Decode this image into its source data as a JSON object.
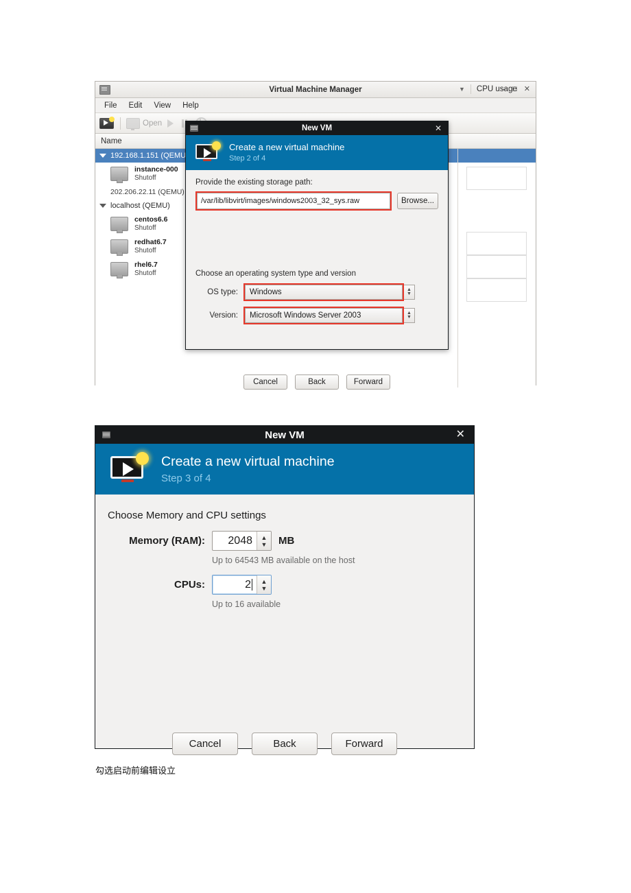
{
  "main_window": {
    "title": "Virtual Machine Manager",
    "window_controls": {
      "minimize": "–",
      "maximize": "□",
      "close": "✕"
    },
    "menu": [
      {
        "label": "File"
      },
      {
        "label": "Edit"
      },
      {
        "label": "View"
      },
      {
        "label": "Help"
      }
    ],
    "toolbar": {
      "new_vm_tooltip": "Create a new virtual machine",
      "open_label": "Open"
    },
    "columns": {
      "name": "Name",
      "cpu_usage": "CPU usage"
    },
    "tree": [
      {
        "type": "host",
        "label": "192.168.1.151 (QEMU)",
        "selected": true,
        "expanded": true
      },
      {
        "type": "vm",
        "name": "instance-000",
        "state": "Shutoff"
      },
      {
        "type": "host",
        "label": "202.206.22.11 (QEMU) –",
        "selected": false,
        "expanded": false
      },
      {
        "type": "host",
        "label": "localhost (QEMU)",
        "selected": false,
        "expanded": true
      },
      {
        "type": "vm",
        "name": "centos6.6",
        "state": "Shutoff"
      },
      {
        "type": "vm",
        "name": "redhat6.7",
        "state": "Shutoff"
      },
      {
        "type": "vm",
        "name": "rhel6.7",
        "state": "Shutoff"
      }
    ]
  },
  "dialog_step2": {
    "window_title": "New VM",
    "close_glyph": "✕",
    "header_title": "Create a new virtual machine",
    "header_step": "Step 2 of 4",
    "storage_label": "Provide the existing storage path:",
    "storage_path": "/var/lib/libvirt/images/windows2003_32_sys.raw",
    "browse_label": "Browse...",
    "os_section_label": "Choose an operating system type and version",
    "os_type_label": "OS type:",
    "os_type_value": "Windows",
    "version_label": "Version:",
    "version_value": "Microsoft Windows Server 2003",
    "buttons": {
      "cancel": "Cancel",
      "back": "Back",
      "forward": "Forward"
    }
  },
  "dialog_step3": {
    "window_title": "New VM",
    "close_glyph": "✕",
    "header_title": "Create a new virtual machine",
    "header_step": "Step 3 of 4",
    "section_label": "Choose Memory and CPU settings",
    "memory_label": "Memory (RAM):",
    "memory_value": "2048",
    "memory_unit": "MB",
    "memory_hint": "Up to 64543 MB available on the host",
    "cpus_label": "CPUs:",
    "cpus_value": "2",
    "cpus_hint": "Up to 16 available",
    "buttons": {
      "cancel": "Cancel",
      "back": "Back",
      "forward": "Forward"
    }
  },
  "caption": "勾选启动前编辑设立",
  "colors": {
    "header_blue": "#0571a8",
    "selection_blue": "#4a81bd",
    "highlight_red": "#e8372a",
    "titlebar_dark": "#17191b"
  }
}
